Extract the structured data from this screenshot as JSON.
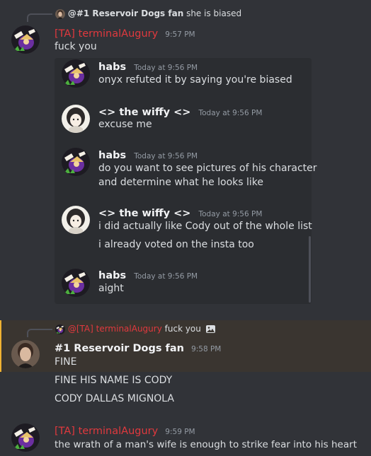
{
  "reply1": {
    "name": "@#1 Reservoir Dogs fan",
    "text": "she is biased"
  },
  "msg1": {
    "author": "[TA] terminalAugury",
    "time": "9:57 PM",
    "text": "fuck you",
    "forward": [
      {
        "author": "habs",
        "time": "Today at 9:56 PM",
        "lines": [
          "onyx refuted it by saying you're biased"
        ]
      },
      {
        "author": "<> the wiffy <>",
        "time": "Today at 9:56 PM",
        "lines": [
          "excuse me"
        ]
      },
      {
        "author": "habs",
        "time": "Today at 9:56 PM",
        "lines": [
          "do you want to see pictures of his character",
          "and determine what he looks like"
        ]
      },
      {
        "author": "<> the wiffy <>",
        "time": "Today at 9:56 PM",
        "lines": [
          "i did actually like Cody out of the whole list",
          "i already voted on the insta too"
        ]
      },
      {
        "author": "habs",
        "time": "Today at 9:56 PM",
        "lines": [
          "aight"
        ]
      }
    ]
  },
  "reply2": {
    "name": "@[TA] terminalAugury",
    "text": "fuck you"
  },
  "msg2": {
    "author": "#1 Reservoir Dogs fan",
    "time": "9:58 PM",
    "lines": [
      "FINE",
      "FINE HIS NAME IS CODY",
      "CODY DALLAS MIGNOLA"
    ]
  },
  "msg3": {
    "author": "[TA] terminalAugury",
    "time": "9:59 PM",
    "text": "the wrath of a man's wife is enough to strike fear into his heart"
  },
  "colors": {
    "background": "#313338",
    "embed": "#2b2d31",
    "highlight": "#3a3530",
    "red_name": "#e0393e"
  }
}
